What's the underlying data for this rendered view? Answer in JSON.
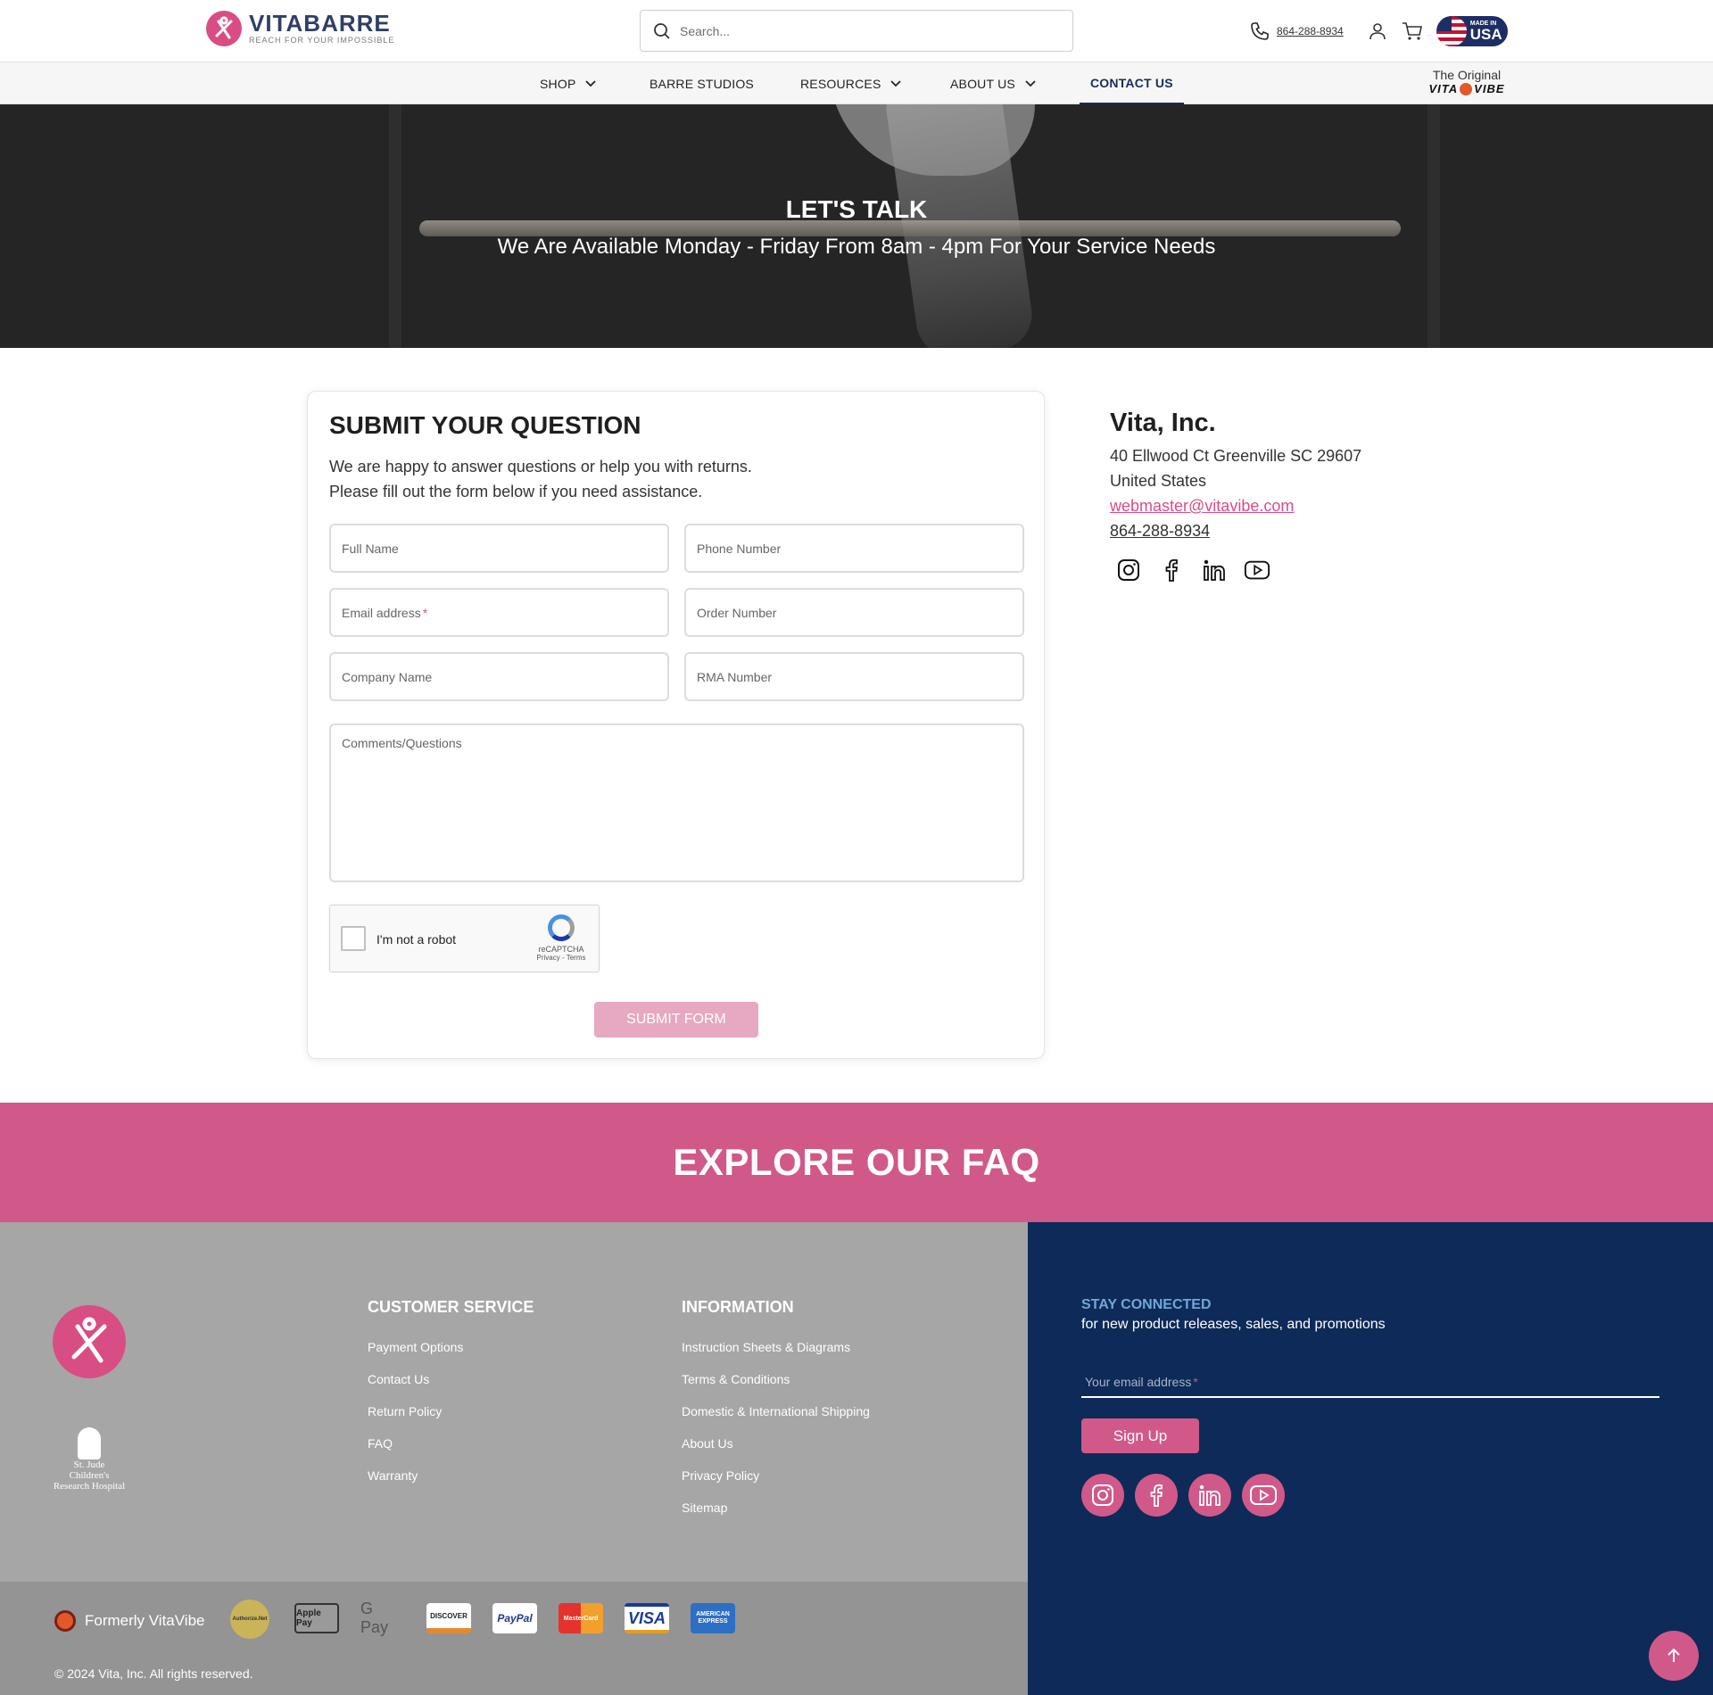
{
  "header": {
    "brand": "VITABARRE",
    "tagline": "REACH FOR YOUR IMPOSSIBLE",
    "search_placeholder": "Search...",
    "phone": "864-288-8934",
    "badge_small": "MADE IN",
    "badge_big": "USA"
  },
  "nav": {
    "items": [
      {
        "label": "SHOP"
      },
      {
        "label": "BARRE STUDIOS"
      },
      {
        "label": "RESOURCES"
      },
      {
        "label": "ABOUT US"
      },
      {
        "label": "CONTACT US"
      }
    ],
    "original_line1": "The Original",
    "original_left": "VITA",
    "original_right": "VIBE"
  },
  "hero": {
    "title": "LET'S TALK",
    "subtitle": "We Are Available Monday - Friday From 8am - 4pm For Your Service Needs"
  },
  "form": {
    "title": "SUBMIT YOUR QUESTION",
    "intro_line1": "We are happy to answer questions or help you with returns.",
    "intro_line2": "Please fill out the form below if you need assistance.",
    "fields": {
      "full_name": "Full Name",
      "phone": "Phone Number",
      "email": "Email address",
      "order": "Order Number",
      "company": "Company Name",
      "rma": "RMA Number",
      "comments": "Comments/Questions"
    },
    "required_mark": "*",
    "captcha_label": "I'm not a robot",
    "captcha_brand": "reCAPTCHA",
    "captcha_links": "Privacy - Terms",
    "submit": "SUBMIT FORM"
  },
  "company": {
    "name": "Vita, Inc.",
    "address": "40 Ellwood Ct Greenville SC 29607",
    "country": "United States",
    "email": "webmaster@vitavibe.com",
    "phone": "864-288-8934",
    "socials": [
      "instagram-icon",
      "facebook-icon",
      "linkedin-icon",
      "youtube-icon"
    ]
  },
  "faq": {
    "title": "EXPLORE OUR FAQ"
  },
  "footer": {
    "stjude_line1": "St. Jude Children's",
    "stjude_line2": "Research Hospital",
    "customer_service": {
      "title": "CUSTOMER SERVICE",
      "links": [
        "Payment Options",
        "Contact Us",
        "Return Policy",
        "FAQ",
        "Warranty"
      ]
    },
    "information": {
      "title": "INFORMATION",
      "links": [
        "Instruction Sheets & Diagrams",
        "Terms & Conditions",
        "Domestic & International Shipping",
        "About Us",
        "Privacy Policy",
        "Sitemap"
      ]
    },
    "formerly": "Formerly VitaVibe",
    "payments": [
      "Authorize.Net",
      "Apple Pay",
      "G Pay",
      "DISCOVER",
      "PayPal",
      "MasterCard",
      "VISA",
      "AMERICAN EXPRESS"
    ],
    "copyright": "© 2024 Vita, Inc. All rights reserved.",
    "newsletter": {
      "heading": "STAY CONNECTED",
      "subheading": "for new product releases, sales, and promotions",
      "placeholder": "Your email address",
      "button": "Sign Up"
    }
  },
  "colors": {
    "brand_pink": "#d15989",
    "navy": "#0e2a58",
    "footer_gray": "#a6a6a6"
  }
}
